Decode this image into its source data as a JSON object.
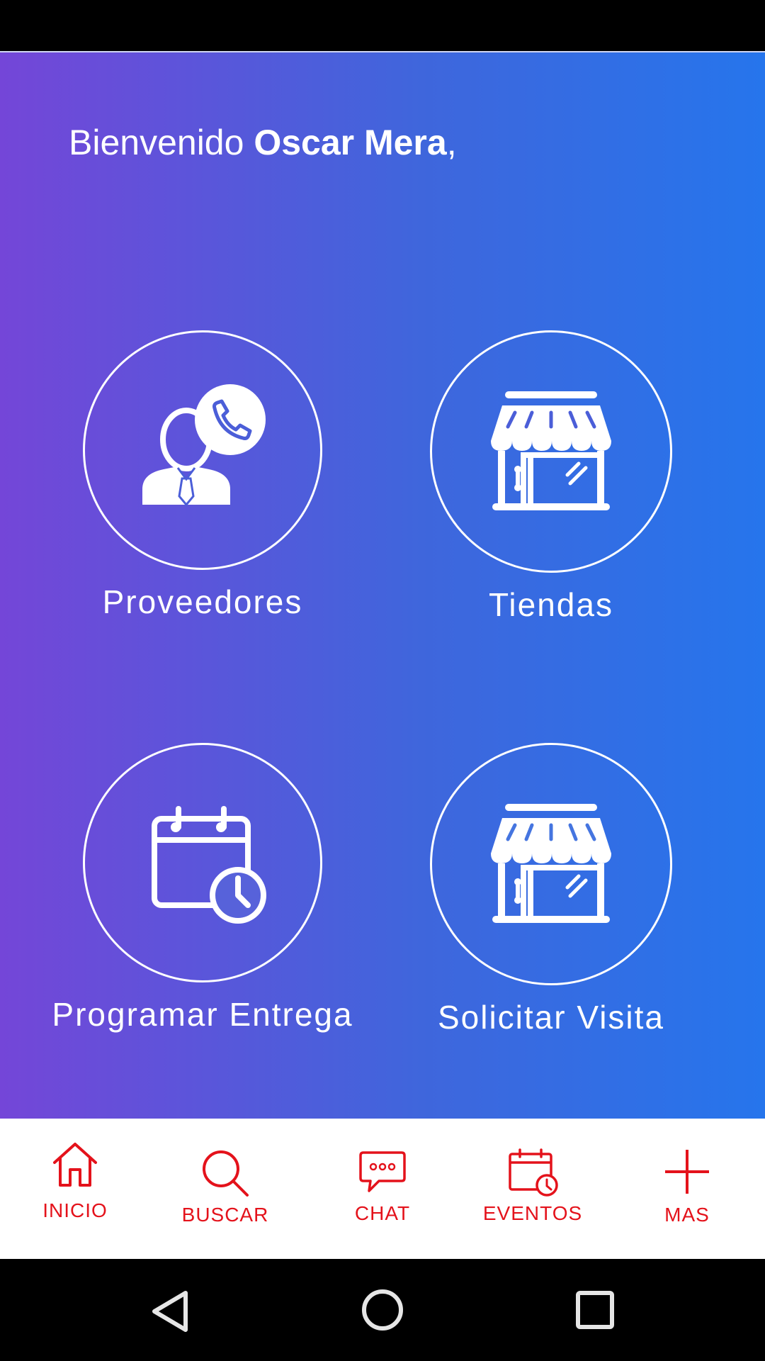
{
  "welcome": {
    "prefix": "Bienvenido ",
    "user_name": "Oscar Mera",
    "suffix": ","
  },
  "tiles": [
    {
      "label": "Proveedores",
      "icon": "supplier-phone-icon"
    },
    {
      "label": "Tiendas",
      "icon": "store-icon"
    },
    {
      "label": "Programar Entrega",
      "icon": "calendar-clock-icon"
    },
    {
      "label": "Solicitar Visita",
      "icon": "store-icon"
    }
  ],
  "bottom_nav": [
    {
      "label": "INICIO",
      "icon": "home-icon"
    },
    {
      "label": "BUSCAR",
      "icon": "search-icon"
    },
    {
      "label": "CHAT",
      "icon": "chat-icon"
    },
    {
      "label": "EVENTOS",
      "icon": "calendar-clock-icon"
    },
    {
      "label": "MAS",
      "icon": "plus-icon"
    }
  ],
  "colors": {
    "gradient_start": "#7446d8",
    "gradient_end": "#2675ec",
    "nav_accent": "#e4121b"
  }
}
